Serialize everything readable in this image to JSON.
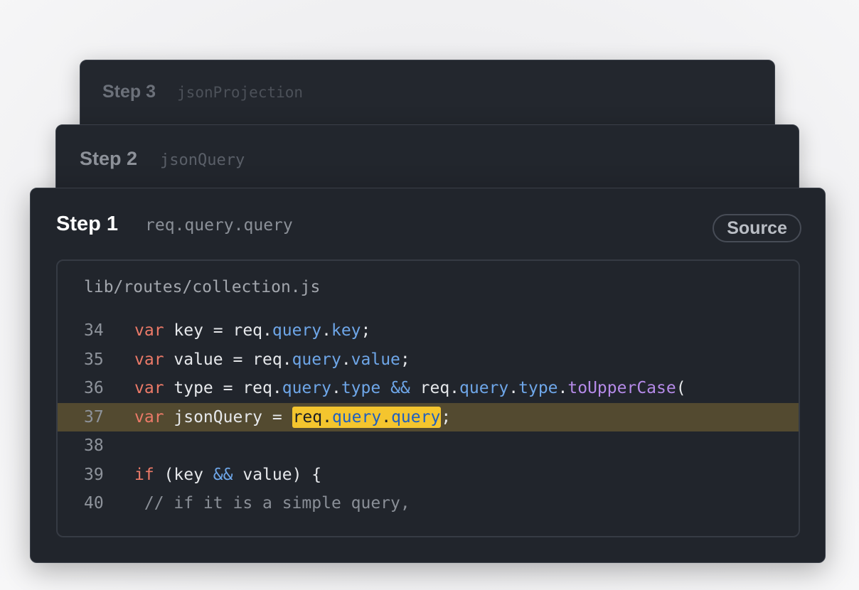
{
  "steps": [
    {
      "title": "Step 3",
      "subtitle": "jsonProjection"
    },
    {
      "title": "Step 2",
      "subtitle": "jsonQuery"
    },
    {
      "title": "Step 1",
      "subtitle": "req.query.query"
    }
  ],
  "source_label": "Source",
  "file_path": "lib/routes/collection.js",
  "code": {
    "lines": [
      {
        "num": "34",
        "tokens": [
          [
            "var",
            "kw"
          ],
          [
            " key = req.",
            ""
          ],
          [
            "query",
            "prop"
          ],
          [
            ".",
            ""
          ],
          [
            "key",
            "prop"
          ],
          [
            ";",
            ""
          ]
        ]
      },
      {
        "num": "35",
        "tokens": [
          [
            "var",
            "kw"
          ],
          [
            " value = req.",
            ""
          ],
          [
            "query",
            "prop"
          ],
          [
            ".",
            ""
          ],
          [
            "value",
            "prop"
          ],
          [
            ";",
            ""
          ]
        ]
      },
      {
        "num": "36",
        "tokens": [
          [
            "var",
            "kw"
          ],
          [
            " type = req.",
            ""
          ],
          [
            "query",
            "prop"
          ],
          [
            ".",
            ""
          ],
          [
            "type",
            "prop"
          ],
          [
            " ",
            ""
          ],
          [
            "&&",
            "op"
          ],
          [
            " req.",
            ""
          ],
          [
            "query",
            "prop"
          ],
          [
            ".",
            ""
          ],
          [
            "type",
            "prop"
          ],
          [
            ".",
            ""
          ],
          [
            "toUpperCase",
            "fn"
          ],
          [
            "(",
            ""
          ]
        ]
      },
      {
        "num": "37",
        "highlighted": true,
        "tokens": [
          [
            "var",
            "kw"
          ],
          [
            " jsonQuery = ",
            ""
          ],
          [
            "req.",
            "hl"
          ],
          [
            "query",
            "hlprop"
          ],
          [
            ".",
            "hl"
          ],
          [
            "query",
            "hlprop"
          ],
          [
            ";",
            ""
          ]
        ]
      },
      {
        "num": "38",
        "tokens": []
      },
      {
        "num": "39",
        "tokens": [
          [
            "if",
            "kw"
          ],
          [
            " (key ",
            ""
          ],
          [
            "&&",
            "op"
          ],
          [
            " value) {",
            ""
          ]
        ]
      },
      {
        "num": "40",
        "tokens": [
          [
            " // if it is a simple query,",
            "cm"
          ]
        ]
      }
    ]
  },
  "colors": {
    "keyword": "#ec7a68",
    "property": "#6ea6e8",
    "function": "#b58ae8",
    "highlight_line": "#534a30",
    "highlight_match": "#f4c52e"
  }
}
